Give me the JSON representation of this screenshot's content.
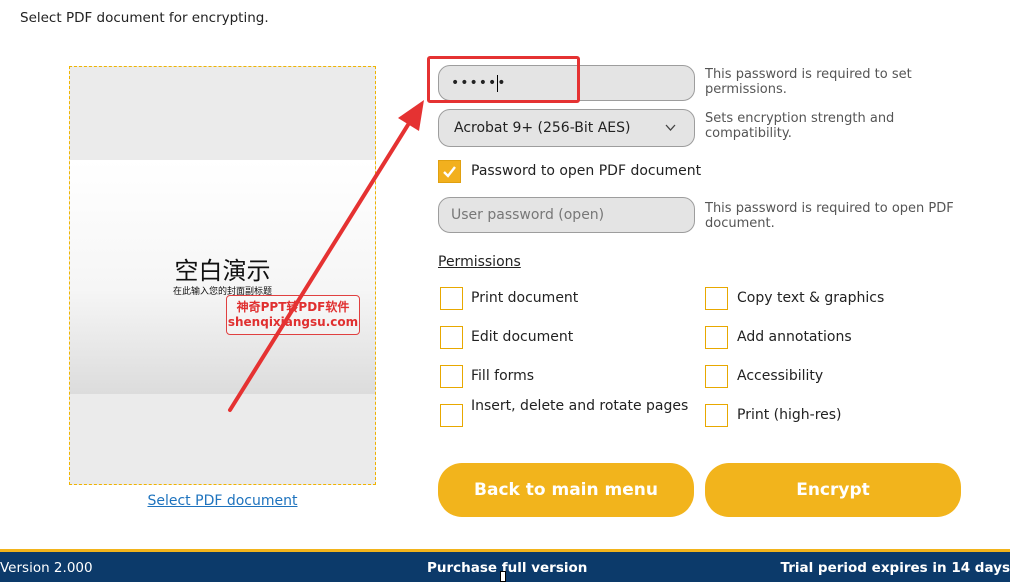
{
  "instruction": "Select PDF document for encrypting.",
  "preview": {
    "title": "空白演示",
    "subtitle": "在此输入您的封面副标题",
    "watermark_line1": "神奇PPT转PDF软件",
    "watermark_line2": "shenqixiangsu.com"
  },
  "select_link": "Select PDF document",
  "owner_password": {
    "value": "••••••",
    "hint": "This password is required to set permissions."
  },
  "encryption": {
    "selected": "Acrobat 9+ (256-Bit AES)",
    "hint": "Sets encryption strength and compatibility."
  },
  "open_password": {
    "checkbox_label": "Password to open PDF document",
    "checked": true,
    "placeholder": "User password (open)",
    "hint": "This password is required to open PDF document."
  },
  "permissions": {
    "title": "Permissions",
    "left": [
      "Print document",
      "Edit document",
      "Fill forms",
      "Insert, delete and rotate pages"
    ],
    "right": [
      "Copy text & graphics",
      "Add annotations",
      "Accessibility",
      "Print (high-res)"
    ]
  },
  "buttons": {
    "back": "Back to main menu",
    "encrypt": "Encrypt"
  },
  "statusbar": {
    "version": "Version 2.000",
    "purchase": "Purchase full version",
    "trial": "Trial period expires in 14 days"
  },
  "colors": {
    "accent": "#f2b41c",
    "statusbar": "#0c3a6a",
    "annotation": "#e53232",
    "link": "#1e73be"
  }
}
